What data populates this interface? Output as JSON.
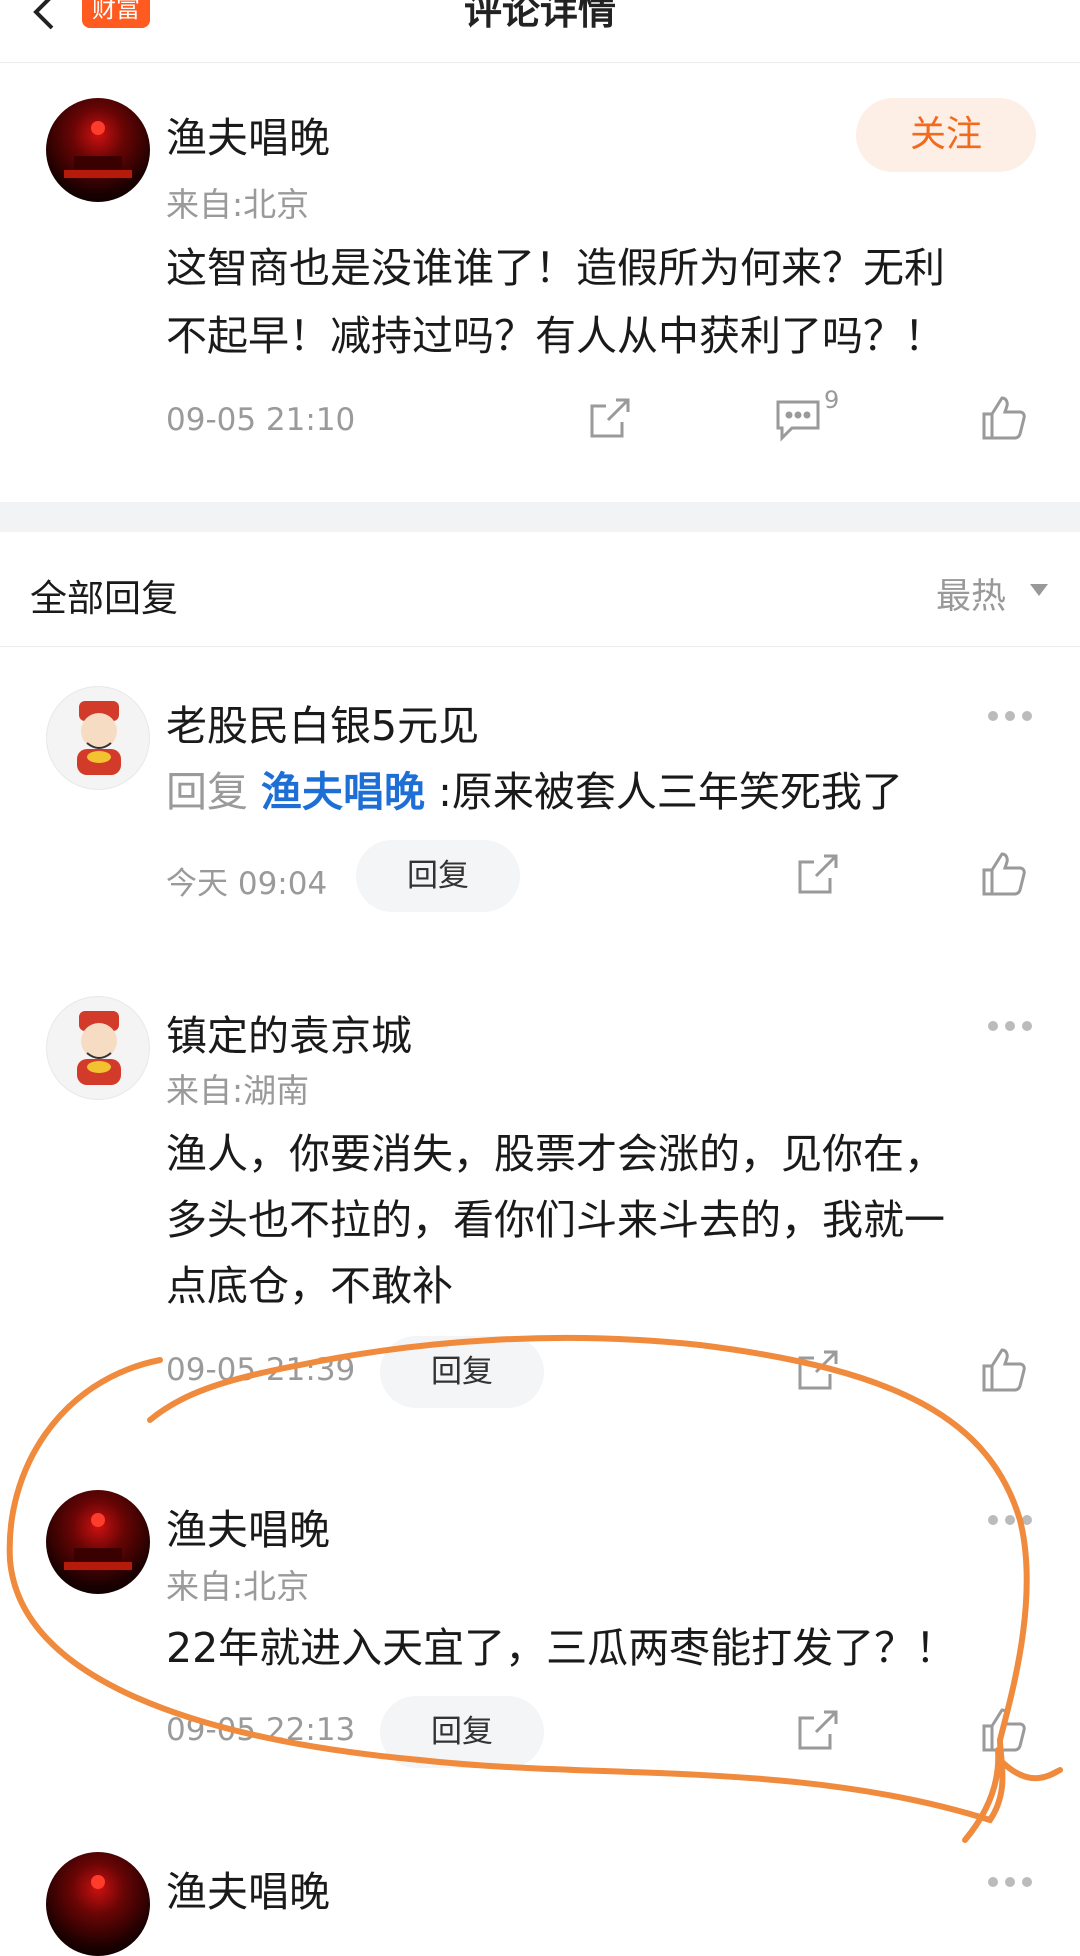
{
  "header": {
    "title": "评论详情",
    "brand_badge": "财富"
  },
  "main_comment": {
    "username": "渔夫唱晚",
    "location": "来自:北京",
    "follow_label": "关注",
    "text_line1": "这智商也是没谁谁了！造假所为何来？无利",
    "text_line2": "不起早！减持过吗？有人从中获利了吗？！",
    "time": "09-05 21:10",
    "reply_count": "9"
  },
  "replies_section": {
    "title": "全部回复",
    "sort": "最热"
  },
  "replies": [
    {
      "username": "老股民白银5元见",
      "reply_prefix": "回复",
      "mention": "渔夫唱晚",
      "text": ":原来被套人三年笑死我了",
      "time": "今天 09:04",
      "reply_label": "回复"
    },
    {
      "username": "镇定的袁京城",
      "location": "来自:湖南",
      "text_line1": "渔人，你要消失，股票才会涨的，见你在，",
      "text_line2": "多头也不拉的，看你们斗来斗去的，我就一",
      "text_line3": "点底仓，不敢补",
      "time": "09-05 21:39",
      "reply_label": "回复"
    },
    {
      "username": "渔夫唱晚",
      "location": "来自:北京",
      "text": "22年就进入天宜了，三瓜两枣能打发了？！",
      "time": "09-05 22:13",
      "reply_label": "回复"
    },
    {
      "username": "渔夫唱晚"
    }
  ],
  "colors": {
    "accent_orange": "#f26a1b",
    "mention_blue": "#1d6fd6",
    "annotation_stroke": "#f08a3c"
  }
}
